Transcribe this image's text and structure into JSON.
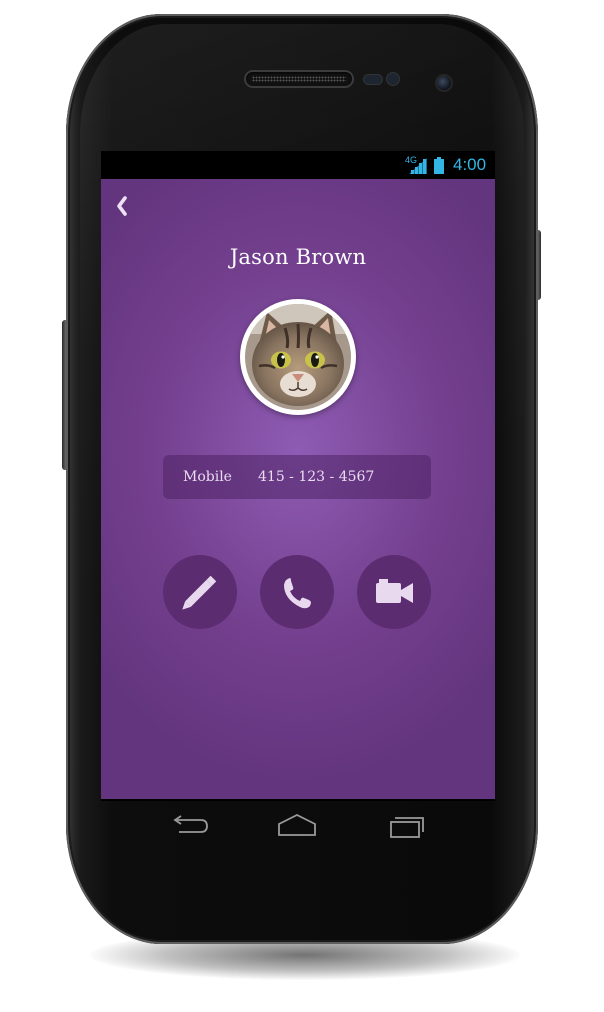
{
  "status_bar": {
    "network": "4G",
    "time": "4:00",
    "accent_color": "#33b5e5"
  },
  "contact": {
    "back_icon": "chevron-left-icon",
    "name": "Jason Brown",
    "avatar": "cat-photo",
    "phone_type": "Mobile",
    "phone_number": "415 - 123 - 4567"
  },
  "actions": [
    {
      "icon": "pencil-icon"
    },
    {
      "icon": "phone-icon"
    },
    {
      "icon": "video-camera-icon"
    }
  ],
  "nav_keys": [
    {
      "icon": "back-arrow-icon"
    },
    {
      "icon": "home-icon"
    },
    {
      "icon": "recent-apps-icon"
    }
  ],
  "colors": {
    "background": "#74408f",
    "button": "#5b2c70",
    "text": "#ffffff"
  }
}
